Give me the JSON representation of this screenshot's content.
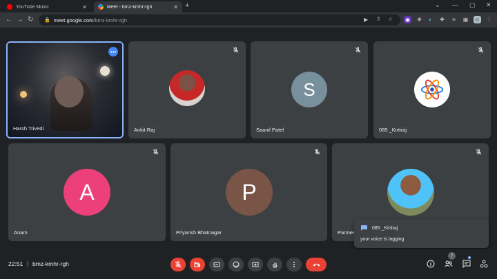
{
  "browser": {
    "tabs": [
      {
        "label": "YouTube Music",
        "active": false
      },
      {
        "label": "Meet - bmz-kmhr-rgh",
        "active": true
      }
    ],
    "new_tab_label": "+",
    "url_host": "meet.google.com",
    "url_path": "/bmz-kmhr-rgh"
  },
  "tiles": [
    {
      "name": "Harsh Trivedi",
      "type": "video",
      "muted": false
    },
    {
      "name": "Ankit Raj",
      "type": "photo",
      "muted": true
    },
    {
      "name": "Saanil Patel",
      "type": "letter",
      "letter": "S",
      "color": "#78909c",
      "muted": true
    },
    {
      "name": "085 _Kirtiraj",
      "type": "photo",
      "muted": true
    },
    {
      "name": "Anam",
      "type": "letter",
      "letter": "A",
      "color": "#ec407a",
      "muted": true
    },
    {
      "name": "Priyansh Bhatnagar",
      "type": "letter",
      "letter": "P",
      "color": "#795548",
      "muted": true
    },
    {
      "name": "Parmes",
      "type": "photo",
      "muted": true
    }
  ],
  "toast": {
    "sender": "085 _Kirtiraj",
    "message": "your voice is lagging"
  },
  "bottom": {
    "time": "22:51",
    "separator": "|",
    "meeting_code": "bmz-kmhr-rgh",
    "participant_count": "7"
  },
  "colors": {
    "accent_blue": "#8ab4f8",
    "danger_red": "#ea4335",
    "tile_bg": "#3c4043"
  }
}
